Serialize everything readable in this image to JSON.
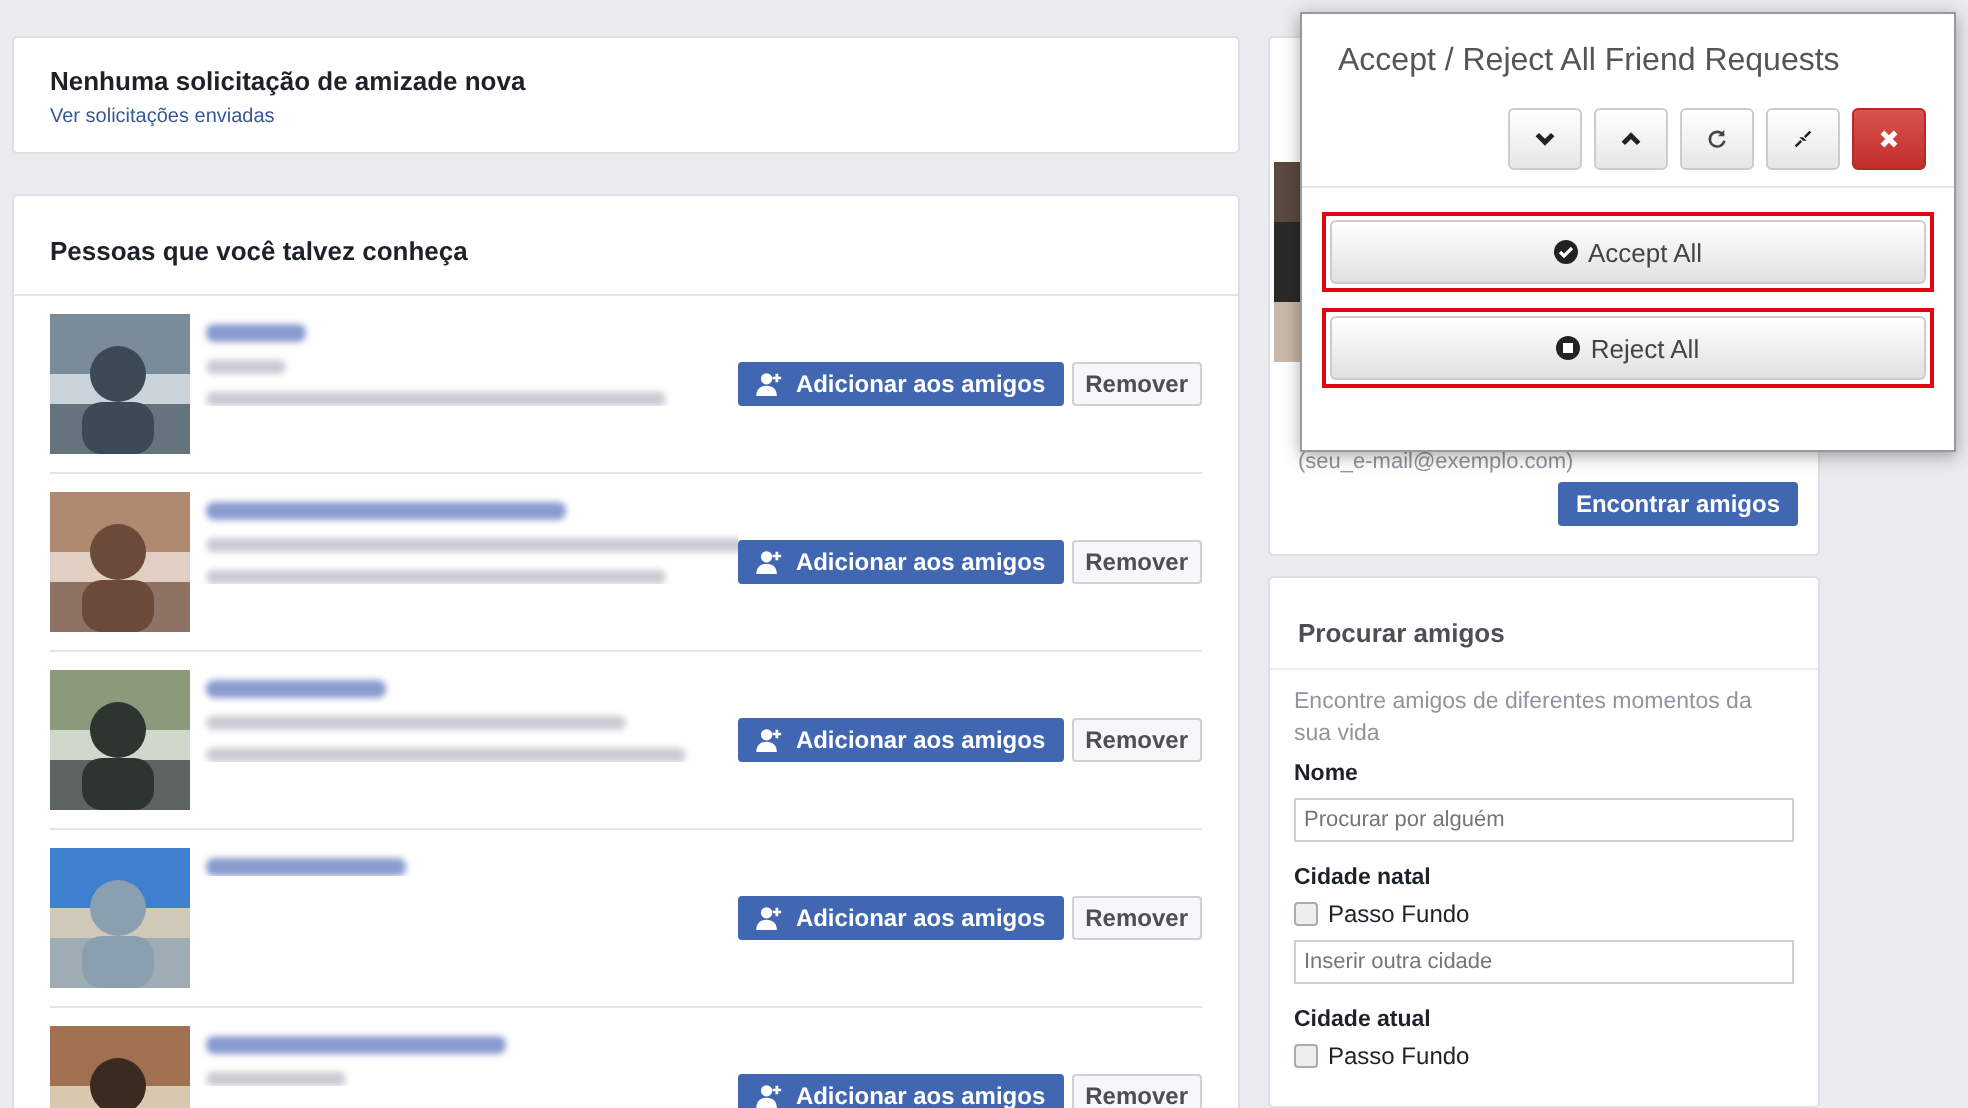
{
  "requests_card": {
    "title": "Nenhuma solicitação de amizade nova",
    "link": "Ver solicitações enviadas"
  },
  "suggestions": {
    "title": "Pessoas que você talvez conheça",
    "people": [
      {
        "kind": "picture",
        "add_label": "Adicionar aos amigos",
        "remove_label": "Remover"
      },
      {
        "kind": "picture",
        "add_label": "Adicionar aos amigos",
        "remove_label": "Remover"
      },
      {
        "kind": "picture",
        "add_label": "Adicionar aos amigos",
        "remove_label": "Remover"
      },
      {
        "kind": "picture",
        "add_label": "Adicionar aos amigos",
        "remove_label": "Remover"
      },
      {
        "kind": "picture",
        "add_label": "Adicionar aos amigos",
        "remove_label": "Remover"
      }
    ]
  },
  "import_card": {
    "email_hint": "(seu_e-mail@exemplo.com)",
    "button": "Encontrar amigos"
  },
  "search_card": {
    "title": "Procurar amigos",
    "description": "Encontre amigos de diferentes momentos da sua vida",
    "fields": [
      {
        "kind": "input",
        "label": "Nome",
        "placeholder": "Procurar por alguém"
      },
      {
        "kind": "options",
        "label": "Cidade natal",
        "option": "Passo Fundo",
        "checked": false,
        "placeholder": "Inserir outra cidade"
      },
      {
        "kind": "options",
        "label": "Cidade atual",
        "option": "Passo Fundo",
        "checked": false
      }
    ]
  },
  "popup": {
    "title": "Accept / Reject All Friend Requests",
    "tools": [
      {
        "kind": "down"
      },
      {
        "kind": "up"
      },
      {
        "kind": "refresh"
      },
      {
        "kind": "collapse"
      },
      {
        "kind": "close"
      }
    ],
    "actions": [
      {
        "kind": "accept",
        "label": "Accept All"
      },
      {
        "kind": "reject",
        "label": "Reject All"
      }
    ]
  }
}
